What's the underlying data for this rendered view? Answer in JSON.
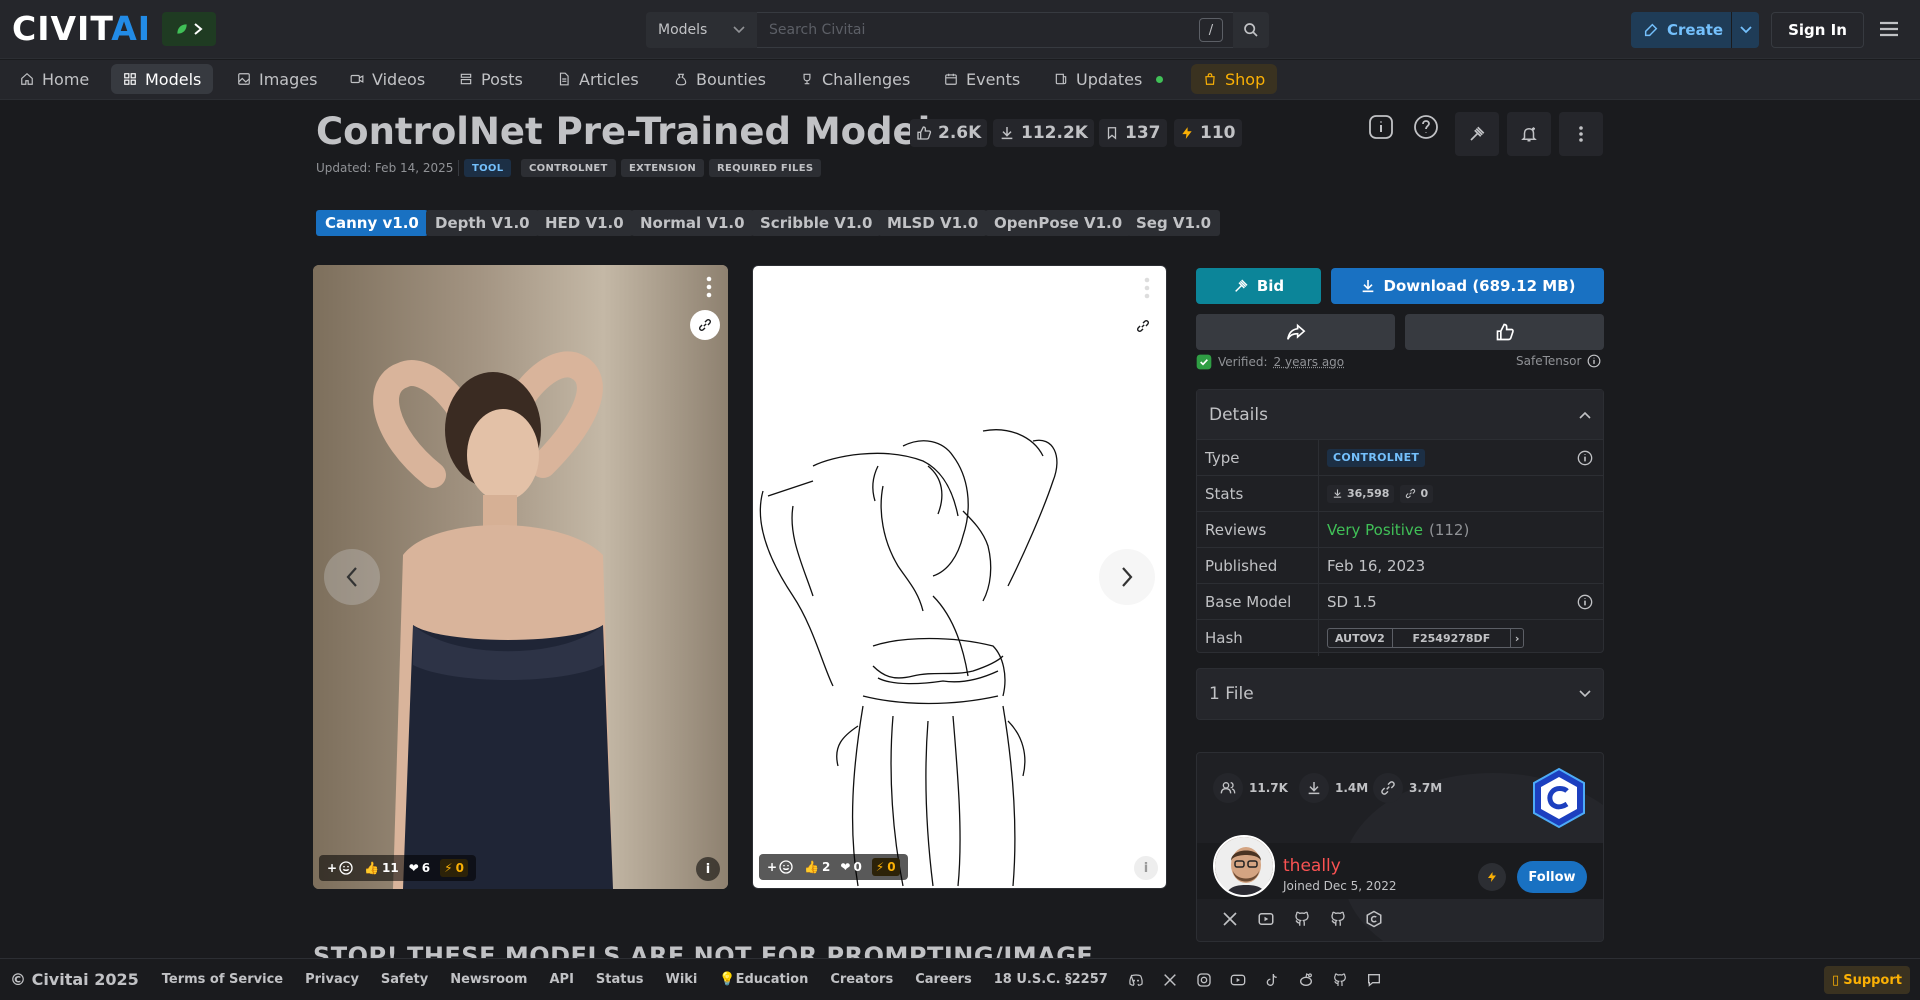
{
  "header": {
    "logo_text_a": "CIVIT",
    "logo_text_b": "AI",
    "search_scope": "Models",
    "search_placeholder": "Search Civitai",
    "search_shortcut": "/",
    "create_label": "Create",
    "signin_label": "Sign In"
  },
  "nav": {
    "items": [
      {
        "label": "Home",
        "icon": "home-icon"
      },
      {
        "label": "Models",
        "icon": "grid-icon"
      },
      {
        "label": "Images",
        "icon": "image-icon"
      },
      {
        "label": "Videos",
        "icon": "video-icon"
      },
      {
        "label": "Posts",
        "icon": "posts-icon"
      },
      {
        "label": "Articles",
        "icon": "article-icon"
      },
      {
        "label": "Bounties",
        "icon": "bounty-icon"
      },
      {
        "label": "Challenges",
        "icon": "trophy-icon"
      },
      {
        "label": "Events",
        "icon": "calendar-icon"
      },
      {
        "label": "Updates",
        "icon": "updates-icon"
      },
      {
        "label": "Shop",
        "icon": "shop-icon"
      }
    ],
    "active": "Models"
  },
  "model": {
    "title": "ControlNet Pre-Trained Models",
    "likes": "2.6K",
    "downloads": "112.2K",
    "bookmarks": "137",
    "buzz": "110",
    "updated": "Updated: Feb 14, 2025",
    "tags": [
      "TOOL",
      "CONTROLNET",
      "EXTENSION",
      "REQUIRED FILES"
    ],
    "versions": [
      "Canny v1.0",
      "Depth V1.0",
      "HED V1.0",
      "Normal V1.0",
      "Scribble V1.0",
      "MLSD V1.0",
      "OpenPose V1.0",
      "Seg V1.0"
    ],
    "active_version": "Canny v1.0"
  },
  "images": [
    {
      "likes": "11",
      "hearts": "6",
      "buzz": "0"
    },
    {
      "likes": "2",
      "hearts": "0",
      "buzz": "0"
    }
  ],
  "below_heading": "STOP! THESE MODELS ARE NOT FOR PROMPTING/IMAGE",
  "actions": {
    "bid": "Bid",
    "download": "Download (689.12 MB)",
    "verified_label": "Verified:",
    "verified_date": "2 years ago",
    "safetensor": "SafeTensor"
  },
  "details": {
    "heading": "Details",
    "rows": {
      "type_label": "Type",
      "type_value": "CONTROLNET",
      "stats_label": "Stats",
      "stats_downloads": "36,598",
      "stats_gens": "0",
      "reviews_label": "Reviews",
      "reviews_value": "Very Positive",
      "reviews_count": "(112)",
      "published_label": "Published",
      "published_value": "Feb 16, 2023",
      "base_label": "Base Model",
      "base_value": "SD 1.5",
      "hash_label": "Hash",
      "hash_type": "AUTOV2",
      "hash_value": "F2549278DF"
    }
  },
  "files": {
    "label": "1 File"
  },
  "creator": {
    "followers": "11.7K",
    "downloads": "1.4M",
    "generations": "3.7M",
    "name": "theally",
    "joined": "Joined Dec 5, 2022",
    "follow": "Follow"
  },
  "footer": {
    "copyright": "© Civitai 2025",
    "links": [
      "Terms of Service",
      "Privacy",
      "Safety",
      "Newsroom",
      "API",
      "Status",
      "Wiki",
      "💡Education",
      "Creators",
      "Careers",
      "18 U.S.C. §2257"
    ],
    "support": "Support"
  },
  "colors": {
    "accent": "#1971c2",
    "background": "#1a1b1e",
    "buzz": "#fab005",
    "positive": "#40c057"
  }
}
